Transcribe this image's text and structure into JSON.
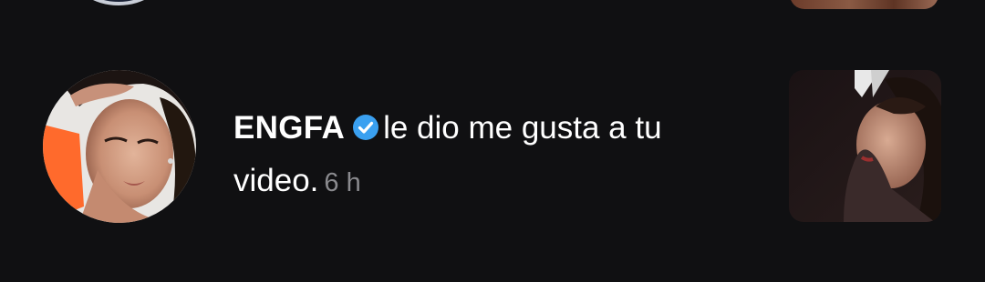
{
  "notification": {
    "username": "ENGFA",
    "verified": true,
    "action": "le dio me gusta a tu video.",
    "timestamp": "6 h",
    "avatar_icon": "profile-photo-avatar",
    "thumbnail_icon": "video-thumbnail"
  },
  "colors": {
    "background": "#101012",
    "text": "#ffffff",
    "timestamp": "#8a8a8e",
    "verified_badge": "#3aa0f0"
  }
}
